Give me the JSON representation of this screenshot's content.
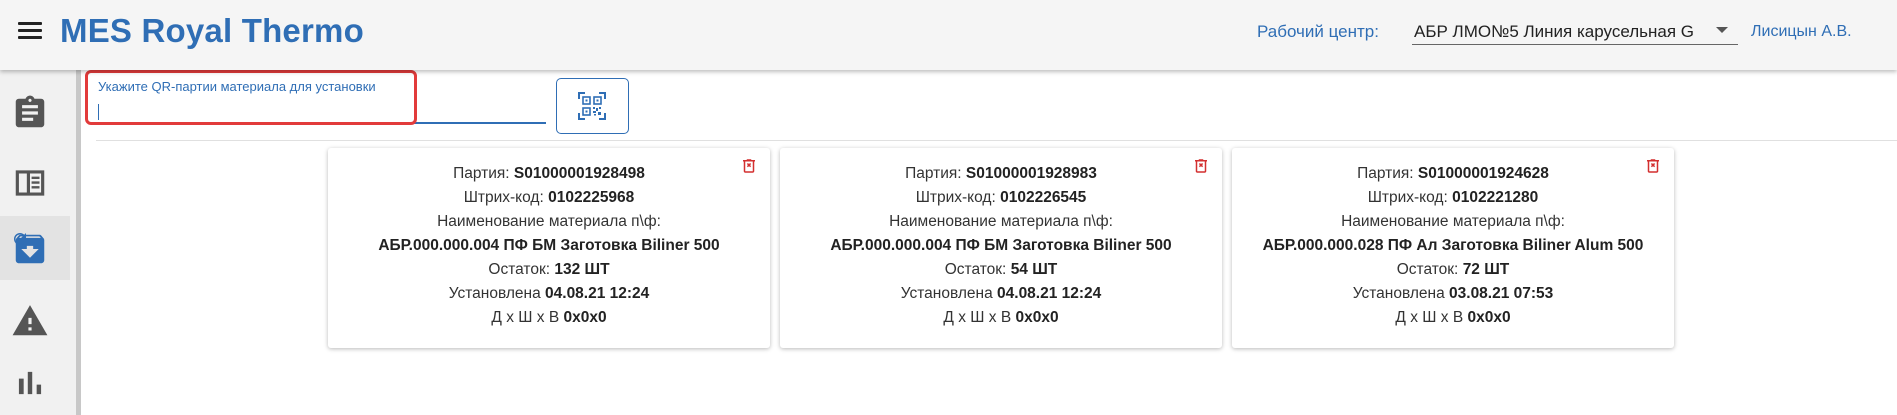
{
  "header": {
    "title": "MES Royal Thermo",
    "work_center_label": "Рабочий центр:",
    "work_center_value": "АБР ЛМО№5 Линия карусельная G",
    "user_name": "Лисицын А.В."
  },
  "sidebar": {
    "items": [
      {
        "icon": "clipboard-icon"
      },
      {
        "icon": "list-panel-icon"
      },
      {
        "icon": "archive-download-icon",
        "badge": "refresh-icon"
      },
      {
        "icon": "warning-icon"
      },
      {
        "icon": "bar-chart-icon"
      }
    ]
  },
  "qr_field": {
    "label": "Укажите QR-партии материала для установки",
    "value": ""
  },
  "card_labels": {
    "batch": "Партия:",
    "barcode": "Штрих-код:",
    "material": "Наименование материала п\\ф:",
    "remainder": "Остаток:",
    "installed": "Установлена",
    "dimensions": "Д x Ш x В"
  },
  "cards": [
    {
      "batch": "S01000001928498",
      "barcode": "0102225968",
      "material_name": "АБР.000.000.004 ПФ БМ Заготовка Biliner 500",
      "remainder": "132 ШТ",
      "installed": "04.08.21 12:24",
      "dimensions": "0x0x0"
    },
    {
      "batch": "S01000001928983",
      "barcode": "0102226545",
      "material_name": "АБР.000.000.004 ПФ БМ Заготовка Biliner 500",
      "remainder": "54 ШТ",
      "installed": "04.08.21 12:24",
      "dimensions": "0x0x0"
    },
    {
      "batch": "S01000001924628",
      "barcode": "0102221280",
      "material_name": "АБР.000.000.028 ПФ Ал Заготовка Biliner Alum 500",
      "remainder": "72 ШТ",
      "installed": "03.08.21 07:53",
      "dimensions": "0x0x0"
    }
  ],
  "colors": {
    "accent": "#2f6eb5",
    "delete": "#d32f2f",
    "highlight": "#e23b3b"
  }
}
